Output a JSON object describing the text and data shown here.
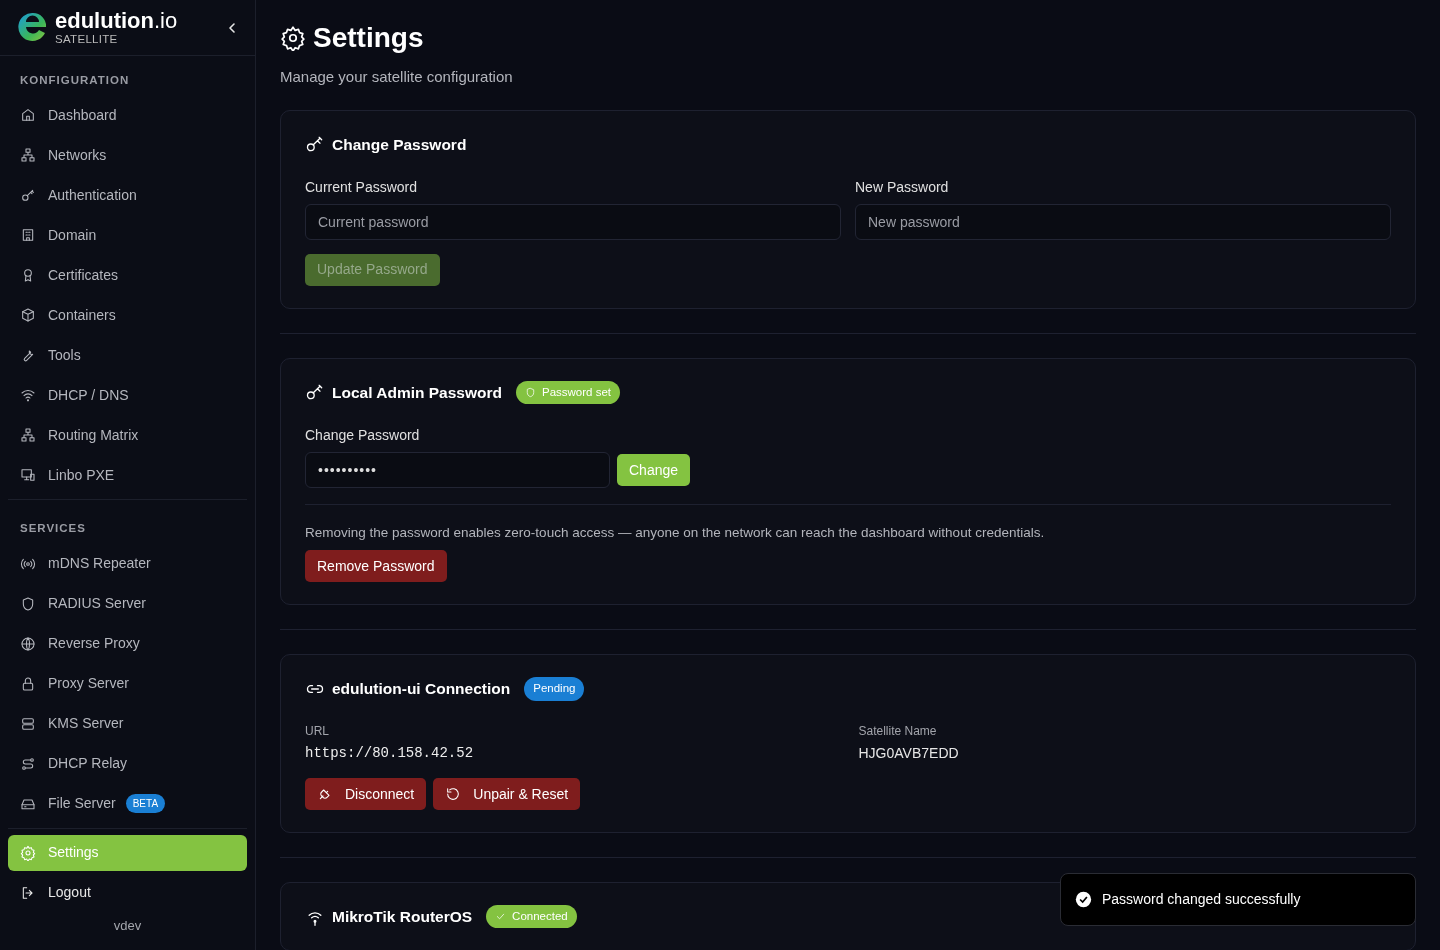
{
  "brand": {
    "name": "edulution",
    "suffix": ".io",
    "subtitle": "SATELLITE"
  },
  "sidebar": {
    "sections": [
      {
        "title": "KONFIGURATION",
        "items": [
          {
            "label": "Dashboard",
            "selected": false
          },
          {
            "label": "Networks",
            "selected": false
          },
          {
            "label": "Authentication",
            "selected": false
          },
          {
            "label": "Domain",
            "selected": false
          },
          {
            "label": "Certificates",
            "selected": false
          },
          {
            "label": "Containers",
            "selected": false
          },
          {
            "label": "Tools",
            "selected": false
          },
          {
            "label": "DHCP / DNS",
            "selected": false
          },
          {
            "label": "Routing Matrix",
            "selected": false
          },
          {
            "label": "Linbo PXE",
            "selected": false
          }
        ]
      },
      {
        "title": "SERVICES",
        "items": [
          {
            "label": "mDNS Repeater",
            "selected": false
          },
          {
            "label": "RADIUS Server",
            "selected": false
          },
          {
            "label": "Reverse Proxy",
            "selected": false
          },
          {
            "label": "Proxy Server",
            "selected": false
          },
          {
            "label": "KMS Server",
            "selected": false
          },
          {
            "label": "DHCP Relay",
            "selected": false
          },
          {
            "label": "File Server",
            "badge": "BETA",
            "selected": false
          }
        ]
      }
    ],
    "footer_items": [
      {
        "label": "Settings",
        "selected": true
      },
      {
        "label": "Logout",
        "selected": false
      }
    ],
    "version": "vdev"
  },
  "page": {
    "title": "Settings",
    "subtitle": "Manage your satellite configuration"
  },
  "cards": [
    {
      "kind": "change_password",
      "title": "Change Password",
      "fields": [
        {
          "label": "Current Password",
          "placeholder": "Current password"
        },
        {
          "label": "New Password",
          "placeholder": "New password"
        }
      ],
      "button": {
        "label": "Update Password",
        "disabled": true
      }
    },
    {
      "kind": "admin_password",
      "title": "Local Admin Password",
      "badge": {
        "label": "Password set",
        "color": "#84c341"
      },
      "field_label": "Change Password",
      "value": "••••••••••",
      "button": "Change",
      "note": "Removing the password enables zero-touch access — anyone on the network can reach the dashboard without credentials.",
      "danger_button": "Remove Password"
    },
    {
      "kind": "connection",
      "title": "edulution-ui Connection",
      "badge": {
        "label": "Pending",
        "color": "#1a7fd4"
      },
      "url_label": "URL",
      "url": "https://80.158.42.52",
      "name_label": "Satellite Name",
      "name": "HJG0AVB7EDD",
      "buttons": [
        "Disconnect",
        "Unpair & Reset"
      ]
    },
    {
      "kind": "router",
      "title": "MikroTik RouterOS",
      "badge": {
        "label": "Connected",
        "color": "#84c341"
      }
    }
  ],
  "toast": {
    "message": "Password changed successfully"
  }
}
